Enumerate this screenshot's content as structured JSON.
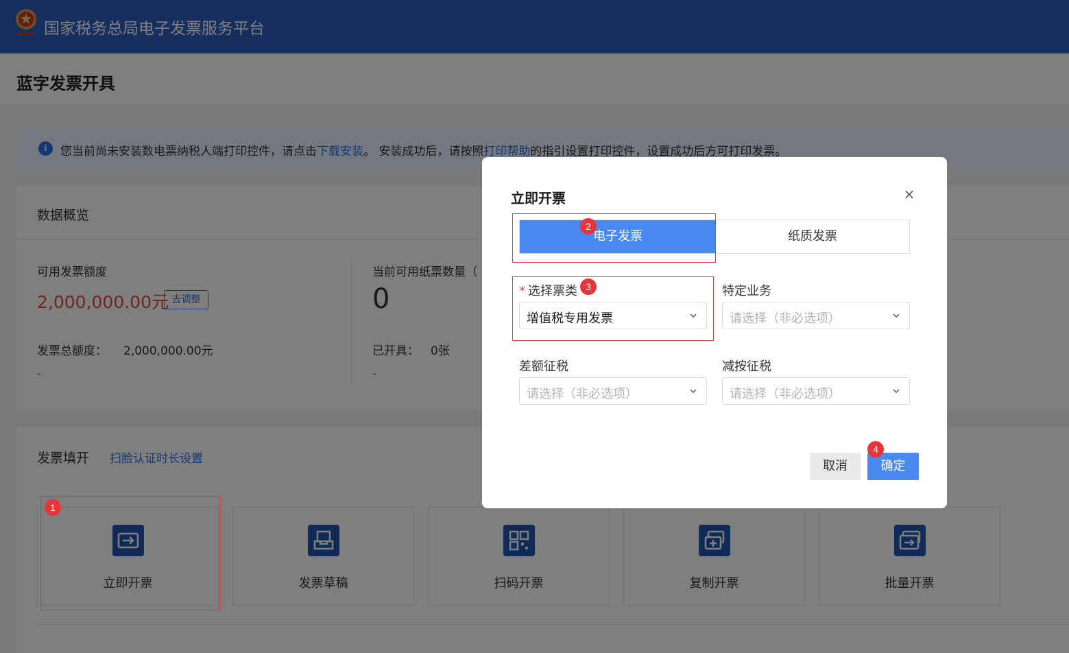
{
  "header": {
    "site_title": "国家税务总局电子发票服务平台",
    "brand_color": "#2f5fbf"
  },
  "page": {
    "title": "蓝字发票开具"
  },
  "notice": {
    "text_before": "您当前尚未安装数电票纳税人端打印控件，请点击",
    "download_link": "下载安装",
    "text_middle": "。 安装成功后，请按照",
    "help_link": "打印帮助",
    "text_after": "的指引设置打印控件，设置成功后方可打印发票。",
    "icon": "info-icon"
  },
  "overview": {
    "title": "数据概览",
    "available_quota_label": "可用发票额度",
    "available_quota_value": "2,000,000.00元",
    "adjust_button": "去调整",
    "total_quota_label": "发票总额度：",
    "total_quota_value": "2,000,000.00元",
    "left_dash": "-",
    "paper_count_label": "当前可用纸票数量（",
    "paper_count_value": "0",
    "issued_label": "已开具：",
    "issued_value": "0张",
    "right_dash": "-"
  },
  "invoice_fill": {
    "title": "发票填开",
    "face_auth_link": "扫脸认证时长设置",
    "cards": [
      {
        "label": "立即开票",
        "icon": "invoice-arrow-icon"
      },
      {
        "label": "发票草稿",
        "icon": "draft-tray-icon"
      },
      {
        "label": "扫码开票",
        "icon": "qr-code-icon"
      },
      {
        "label": "复制开票",
        "icon": "copy-invoice-icon"
      },
      {
        "label": "批量开票",
        "icon": "batch-invoice-icon"
      }
    ]
  },
  "dialog": {
    "title": "立即开票",
    "tabs": [
      {
        "label": "电子发票",
        "active": true
      },
      {
        "label": "纸质发票",
        "active": false
      }
    ],
    "invoice_type_label": "选择票类",
    "invoice_type_value": "增值税专用发票",
    "special_business_label": "特定业务",
    "special_business_placeholder": "请选择（非必选项）",
    "diff_tax_label": "差额征税",
    "diff_tax_placeholder": "请选择（非必选项）",
    "reduced_tax_label": "减按征税",
    "reduced_tax_placeholder": "请选择（非必选项）",
    "cancel_button": "取消",
    "confirm_button": "确定",
    "accent_color": "#4a89f0"
  },
  "annotations": [
    "1",
    "2",
    "3",
    "4"
  ]
}
